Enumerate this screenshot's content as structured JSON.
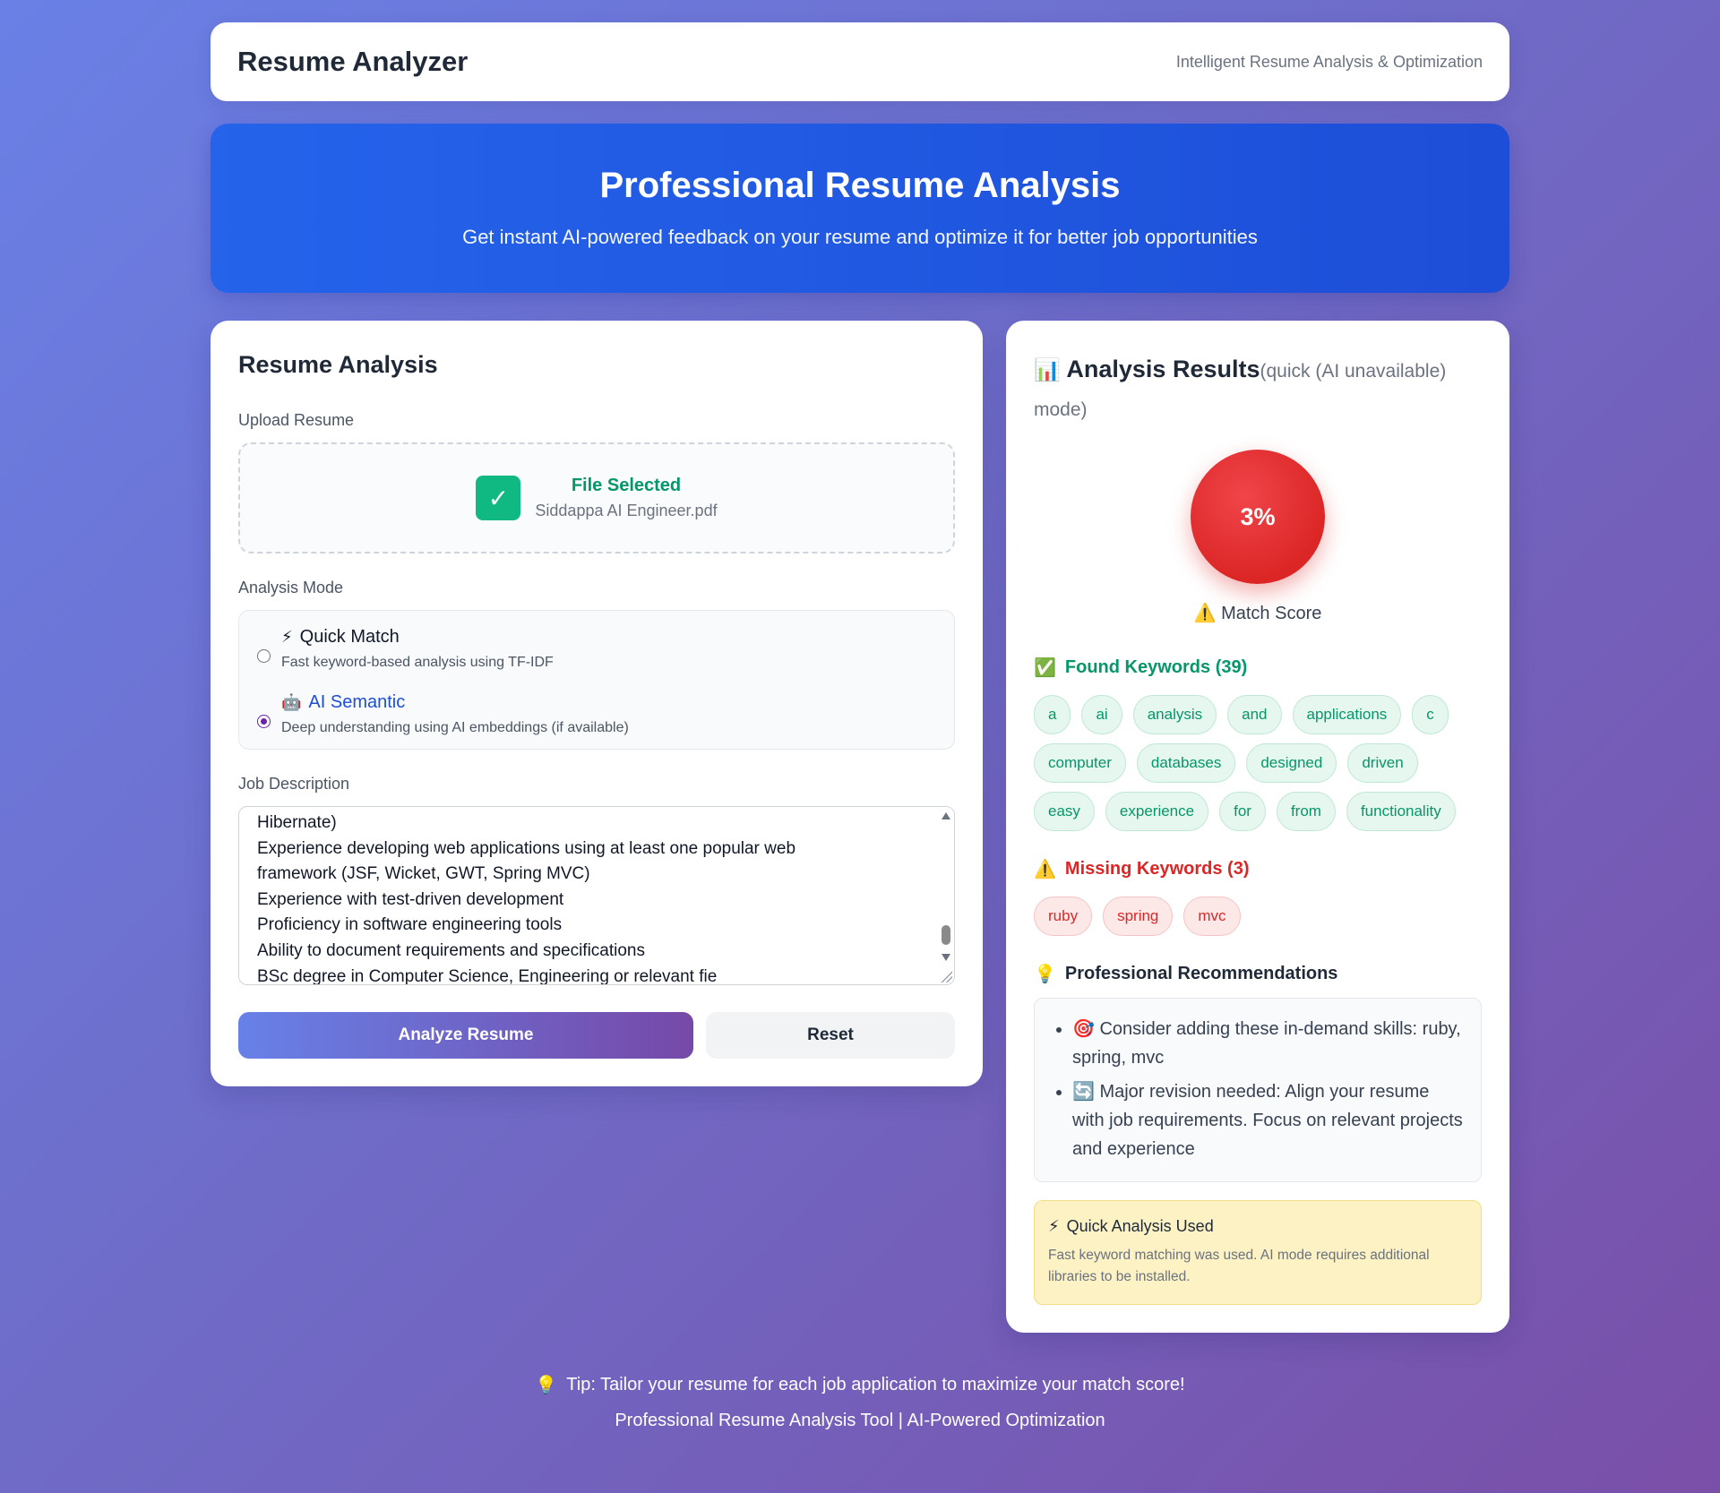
{
  "header": {
    "title": "Resume Analyzer",
    "subtitle": "Intelligent Resume Analysis & Optimization"
  },
  "hero": {
    "title": "Professional Resume Analysis",
    "subtitle": "Get instant AI-powered feedback on your resume and optimize it for better job opportunities"
  },
  "analysis_form": {
    "title": "Resume Analysis",
    "upload_label": "Upload Resume",
    "upload_status": "File Selected",
    "file_name": "Siddappa AI Engineer.pdf",
    "mode_label": "Analysis Mode",
    "modes": [
      {
        "icon": "⚡",
        "title": "Quick Match",
        "description": "Fast keyword-based analysis using TF-IDF",
        "selected": false
      },
      {
        "icon": "🤖",
        "title": "AI Semantic",
        "description": "Deep understanding using AI embeddings (if available)",
        "selected": true
      }
    ],
    "job_description_label": "Job Description",
    "job_description_lines": [
      "Hibernate)",
      "Experience developing web applications using at least one popular web",
      "framework (JSF, Wicket, GWT, Spring MVC)",
      "Experience with test-driven development",
      "Proficiency in software engineering tools",
      "Ability to document requirements and specifications",
      "BSc degree in Computer Science, Engineering or relevant fie"
    ],
    "analyze_button": "Analyze Resume",
    "reset_button": "Reset"
  },
  "results": {
    "icon": "📊",
    "title": "Analysis Results",
    "mode_note": "(quick (AI unavailable) mode)",
    "score": "3%",
    "score_label": "Match Score",
    "score_icon": "⚠️",
    "found_icon": "✅",
    "found_title": "Found Keywords (39)",
    "found_keywords": [
      "a",
      "ai",
      "analysis",
      "and",
      "applications",
      "c",
      "computer",
      "databases",
      "designed",
      "driven",
      "easy",
      "experience",
      "for",
      "from",
      "functionality"
    ],
    "missing_icon": "⚠️",
    "missing_title": "Missing Keywords (3)",
    "missing_keywords": [
      "ruby",
      "spring",
      "mvc"
    ],
    "rec_icon": "💡",
    "recommendations_title": "Professional Recommendations",
    "recommendations": [
      "🎯 Consider adding these in-demand skills: ruby, spring, mvc",
      "🔄 Major revision needed: Align your resume with job requirements. Focus on relevant projects and experience"
    ],
    "notice_icon": "⚡",
    "notice_title": "Quick Analysis Used",
    "notice_text": "Fast keyword matching was used. AI mode requires additional libraries to be installed."
  },
  "footer": {
    "tip_icon": "💡",
    "tip": "Tip: Tailor your resume for each job application to maximize your match score!",
    "credit": "Professional Resume Analysis Tool | AI-Powered Optimization"
  },
  "colors": {
    "accent_blue": "#2563eb",
    "success_green": "#059669",
    "danger_red": "#dc2626",
    "purple": "#7649a8"
  }
}
